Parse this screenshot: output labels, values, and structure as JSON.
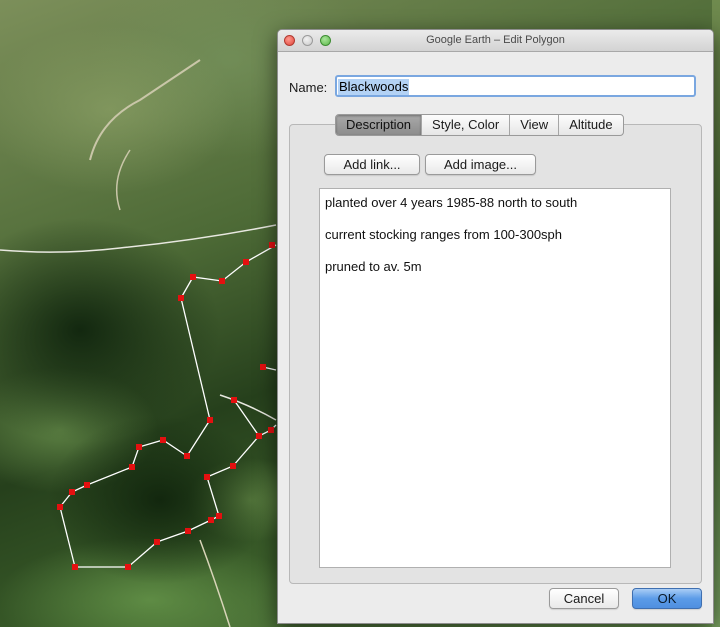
{
  "window": {
    "title": "Google Earth – Edit Polygon"
  },
  "form": {
    "name_label": "Name:",
    "name_value": "Blackwoods"
  },
  "tabs": [
    {
      "label": "Description",
      "active": true
    },
    {
      "label": "Style, Color",
      "active": false
    },
    {
      "label": "View",
      "active": false
    },
    {
      "label": "Altitude",
      "active": false
    }
  ],
  "description_tab": {
    "add_link_label": "Add link...",
    "add_image_label": "Add image...",
    "lines": [
      "planted over 4 years 1985-88 north to south",
      "current stocking ranges from 100-300sph",
      "pruned to av. 5m"
    ]
  },
  "footer": {
    "cancel_label": "Cancel",
    "ok_label": "OK"
  },
  "colors": {
    "polygon_vertex": "#e41010",
    "polygon_edge": "#ffffff",
    "ok_button": "#5c9ce8"
  }
}
